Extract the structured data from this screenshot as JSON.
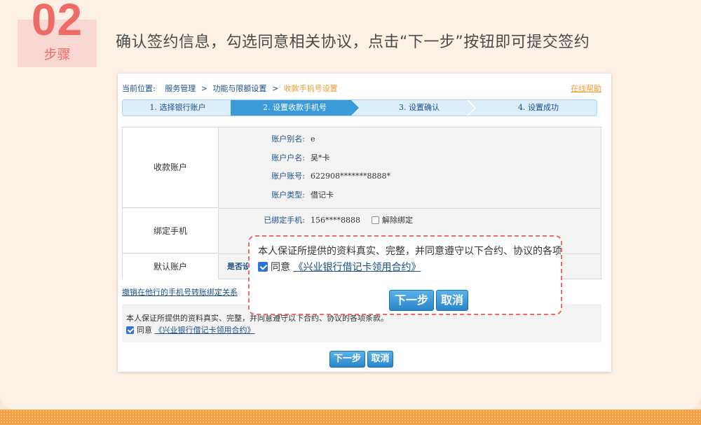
{
  "step": {
    "number": "02",
    "label": "步骤"
  },
  "instruction": "确认签约信息，勾选同意相关协议，点击“下一步”按钮即可提交签约",
  "breadcrumb": {
    "prefix": "当前位置:",
    "items": [
      "服务管理",
      ">",
      "功能与限额设置",
      ">",
      "收款手机号设置"
    ]
  },
  "help_link": "在线帮助",
  "wizard_steps": [
    "1. 选择银行账户",
    "2. 设置收款手机号",
    "3. 设置确认",
    "4. 设置成功"
  ],
  "table": {
    "payee_account_label": "收款账户",
    "fields": [
      {
        "key": "账户别名:",
        "value": "e"
      },
      {
        "key": "账户户名:",
        "value": "吴*卡"
      },
      {
        "key": "账户账号:",
        "value": "622908*******8888*"
      },
      {
        "key": "账户类型:",
        "value": "借记卡"
      }
    ],
    "bind_phone_label": "绑定手机",
    "bound_phone_key": "已绑定手机:",
    "bound_phone_value": "156****8888",
    "unbind_label": "解除绑定",
    "default_account_label": "默认账户",
    "default_account_question": "是否设"
  },
  "revoke_link": "撤销在他行的手机号转账绑定关系",
  "agreement": {
    "text": "本人保证所提供的资料真实、完整，并同意遵守以下合约、协议的各项条款。",
    "agree_label": "同意",
    "contract_link": "《兴业银行借记卡领用合约》"
  },
  "buttons": {
    "next": "下一步",
    "cancel": "取消"
  },
  "zoom": {
    "text": "本人保证所提供的资料真实、完整，并同意遵守以下合约、协议的各项条",
    "agree_label": "同意",
    "contract_link": "《兴业银行借记卡领用合约》"
  },
  "colors": {
    "accent_red": "#ef6b66",
    "link_blue": "#1a4f8c",
    "active_step": "#3b9ad8",
    "highlight_orange": "#f19a2e"
  }
}
